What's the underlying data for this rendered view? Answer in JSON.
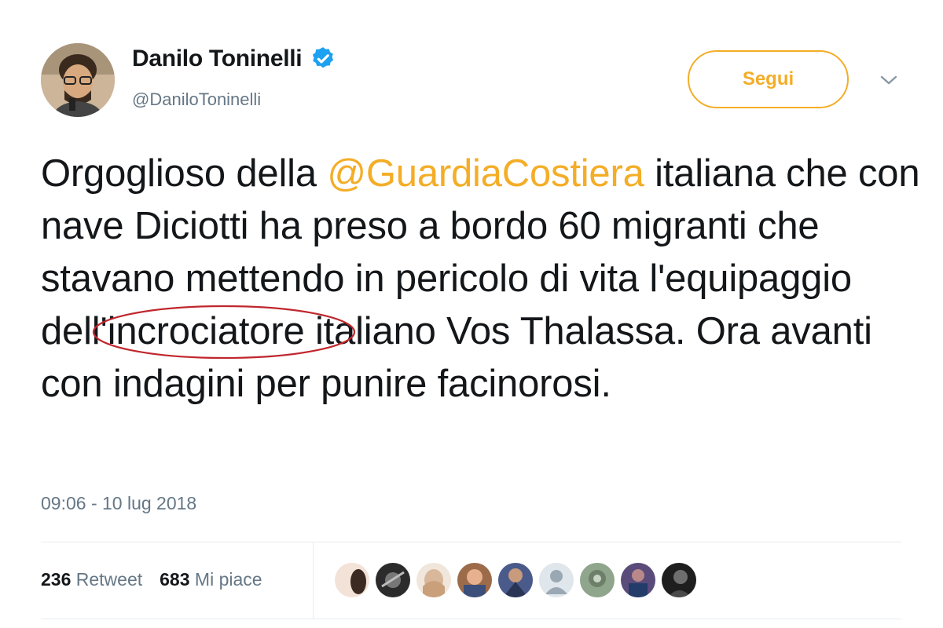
{
  "author": {
    "name": "Danilo Toninelli",
    "handle": "@DaniloToninelli"
  },
  "follow_label": "Segui",
  "tweet": {
    "part1": "Orgoglioso della ",
    "mention": "@GuardiaCostiera",
    "part2": " italiana che con nave Diciotti ha preso a bordo 60 migranti che stavano mettendo in pericolo di vita l'equipaggio dell'",
    "circled_word": "incrociatore",
    "part3": " italiano Vos Thalassa. Ora avanti con indagini per punire facinorosi."
  },
  "timestamp": "09:06 - 10 lug 2018",
  "stats": {
    "retweets_count": "236",
    "retweets_label": "Retweet",
    "likes_count": "683",
    "likes_label": "Mi piace"
  },
  "colors": {
    "accent": "#f4ad27",
    "verified": "#1da1f2",
    "circle": "#c0262d"
  },
  "likers_count": 9
}
